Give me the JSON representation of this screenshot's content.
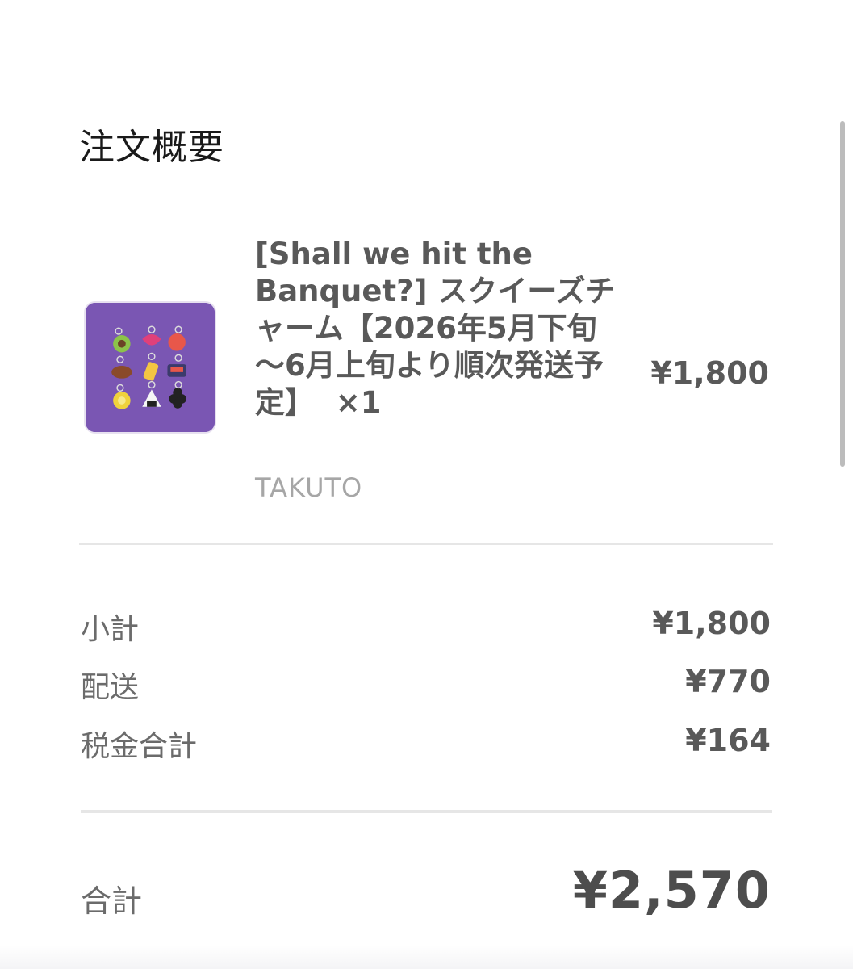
{
  "summary": {
    "title": "注文概要"
  },
  "item": {
    "image_icon": "product-photo",
    "name": "[Shall we hit the Banquet?] スクイーズチャーム【2026年5月下旬～6月上旬より順次発送予定】",
    "quantity": "×1",
    "vendor": "TAKUTO",
    "price": "¥1,800"
  },
  "totals": {
    "subtotal": {
      "label": "小計",
      "value": "¥1,800"
    },
    "shipping": {
      "label": "配送",
      "value": "¥770"
    },
    "tax": {
      "label": "税金合計",
      "value": "¥164"
    },
    "grand_total": {
      "label": "合計",
      "value": "¥2,570"
    }
  },
  "colors": {
    "thumbnail_bg": "#7a56b3",
    "text_primary": "#1a1a1a",
    "text_secondary": "#595959",
    "text_muted": "#a6a6a6",
    "divider": "#e6e6e6"
  }
}
